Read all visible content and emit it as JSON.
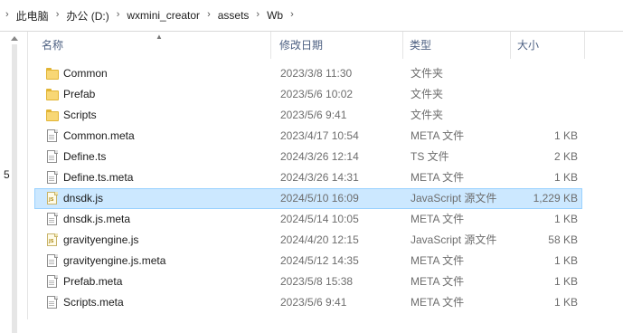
{
  "breadcrumb": [
    "此电脑",
    "办公 (D:)",
    "wxmini_creator",
    "assets",
    "Wb"
  ],
  "sidebar_digit": "5",
  "columns": {
    "name": "名称",
    "date": "修改日期",
    "type": "类型",
    "size": "大小"
  },
  "files": [
    {
      "icon": "folder",
      "name": "Common",
      "date": "2023/3/8 11:30",
      "type": "文件夹",
      "size": ""
    },
    {
      "icon": "folder",
      "name": "Prefab",
      "date": "2023/5/6 10:02",
      "type": "文件夹",
      "size": ""
    },
    {
      "icon": "folder",
      "name": "Scripts",
      "date": "2023/5/6 9:41",
      "type": "文件夹",
      "size": ""
    },
    {
      "icon": "file",
      "name": "Common.meta",
      "date": "2023/4/17 10:54",
      "type": "META 文件",
      "size": "1 KB"
    },
    {
      "icon": "file",
      "name": "Define.ts",
      "date": "2024/3/26 12:14",
      "type": "TS 文件",
      "size": "2 KB"
    },
    {
      "icon": "file",
      "name": "Define.ts.meta",
      "date": "2024/3/26 14:31",
      "type": "META 文件",
      "size": "1 KB"
    },
    {
      "icon": "js",
      "name": "dnsdk.js",
      "date": "2024/5/10 16:09",
      "type": "JavaScript 源文件",
      "size": "1,229 KB",
      "selected": true
    },
    {
      "icon": "file",
      "name": "dnsdk.js.meta",
      "date": "2024/5/14 10:05",
      "type": "META 文件",
      "size": "1 KB"
    },
    {
      "icon": "js",
      "name": "gravityengine.js",
      "date": "2024/4/20 12:15",
      "type": "JavaScript 源文件",
      "size": "58 KB"
    },
    {
      "icon": "file",
      "name": "gravityengine.js.meta",
      "date": "2024/5/12 14:35",
      "type": "META 文件",
      "size": "1 KB"
    },
    {
      "icon": "file",
      "name": "Prefab.meta",
      "date": "2023/5/8 15:38",
      "type": "META 文件",
      "size": "1 KB"
    },
    {
      "icon": "file",
      "name": "Scripts.meta",
      "date": "2023/5/6 9:41",
      "type": "META 文件",
      "size": "1 KB"
    }
  ]
}
